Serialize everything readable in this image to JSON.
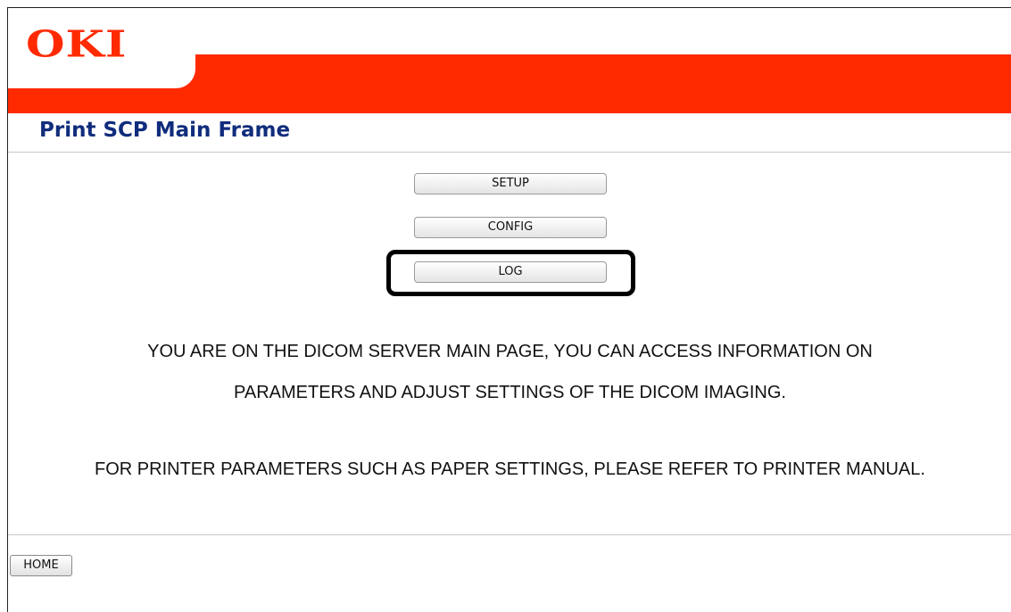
{
  "header": {
    "logo_text": "OKI",
    "page_title": "Print SCP Main Frame"
  },
  "nav": {
    "setup_label": "SETUP",
    "config_label": "CONFIG",
    "log_label": "LOG"
  },
  "main": {
    "info_line1": "YOU ARE ON THE DICOM SERVER MAIN PAGE, YOU CAN ACCESS INFORMATION ON",
    "info_line2": "PARAMETERS AND ADJUST SETTINGS OF THE DICOM IMAGING.",
    "info_line3": "FOR PRINTER PARAMETERS SUCH AS PAPER SETTINGS, PLEASE REFER TO PRINTER MANUAL."
  },
  "footer": {
    "home_label": "HOME"
  },
  "colors": {
    "brand_red": "#ff2a00",
    "title_blue": "#102d7c"
  }
}
